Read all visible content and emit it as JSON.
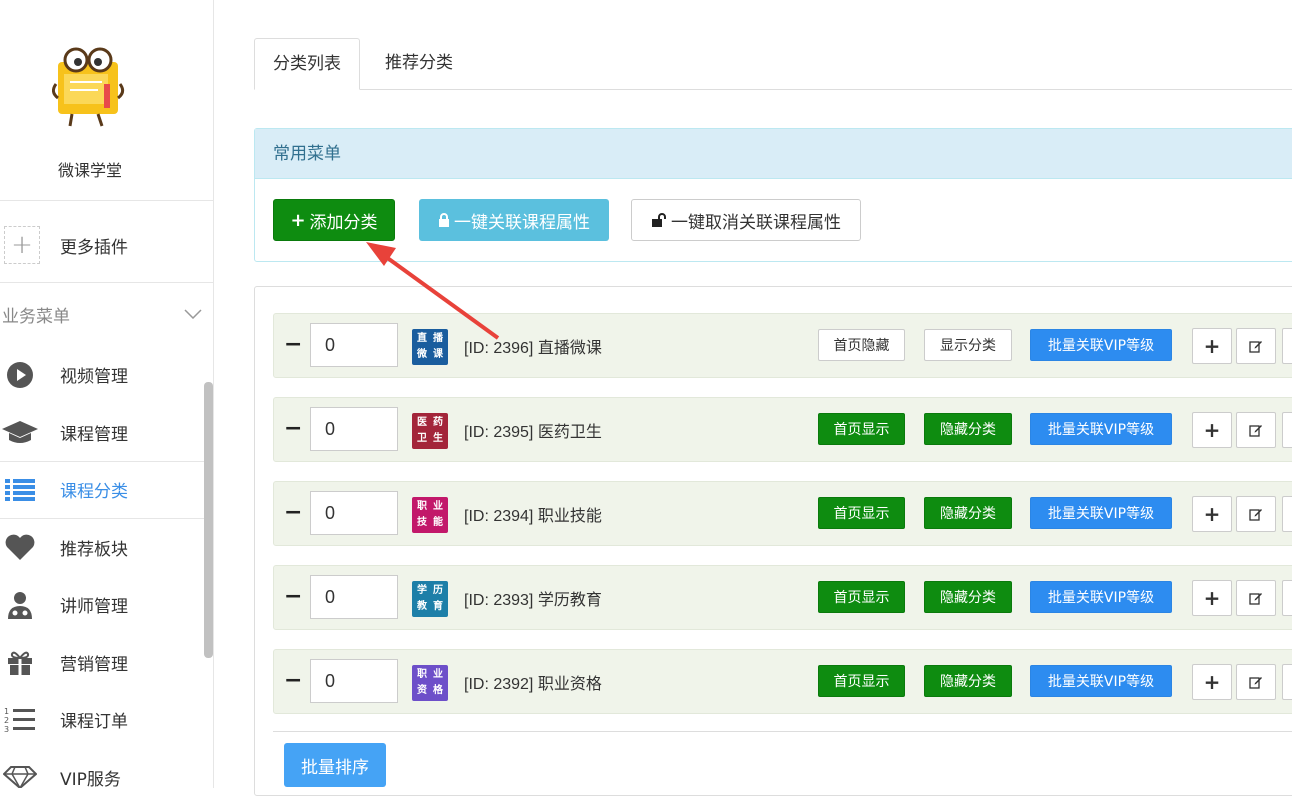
{
  "app": {
    "name": "微课学堂"
  },
  "sidebar": {
    "plugin_label": "更多插件",
    "section_title": "业务菜单",
    "items": [
      {
        "label": "视频管理",
        "icon": "play-icon"
      },
      {
        "label": "课程管理",
        "icon": "graduation-cap-icon"
      },
      {
        "label": "课程分类",
        "icon": "list-icon",
        "active": true
      },
      {
        "label": "推荐板块",
        "icon": "heart-icon"
      },
      {
        "label": "讲师管理",
        "icon": "user-md-icon"
      },
      {
        "label": "营销管理",
        "icon": "gift-icon"
      },
      {
        "label": "课程订单",
        "icon": "ordered-list-icon"
      },
      {
        "label": "VIP服务",
        "icon": "diamond-icon"
      }
    ]
  },
  "tabs": [
    {
      "label": "分类列表",
      "active": true
    },
    {
      "label": "推荐分类",
      "active": false
    }
  ],
  "panel": {
    "title": "常用菜单",
    "add_label": "添加分类",
    "link_label": "一键关联课程属性",
    "unlink_label": "一键取消关联课程属性"
  },
  "rows": [
    {
      "sort": "0",
      "title": "[ID: 2396] 直播微课",
      "thumb": [
        "直",
        "播",
        "微",
        "课"
      ],
      "thumb_color": "#1a5d9e",
      "home_label": "首页隐藏",
      "visibility_label": "显示分类",
      "vip_label": "批量关联VIP等级",
      "style": "white"
    },
    {
      "sort": "0",
      "title": "[ID: 2395] 医药卫生",
      "thumb": [
        "医",
        "药",
        "卫",
        "生"
      ],
      "thumb_color": "#a3253a",
      "home_label": "首页显示",
      "visibility_label": "隐藏分类",
      "vip_label": "批量关联VIP等级",
      "style": "green"
    },
    {
      "sort": "0",
      "title": "[ID: 2394] 职业技能",
      "thumb": [
        "职",
        "业",
        "技",
        "能"
      ],
      "thumb_color": "#c2186a",
      "home_label": "首页显示",
      "visibility_label": "隐藏分类",
      "vip_label": "批量关联VIP等级",
      "style": "green"
    },
    {
      "sort": "0",
      "title": "[ID: 2393] 学历教育",
      "thumb": [
        "学",
        "历",
        "教",
        "育"
      ],
      "thumb_color": "#1d7fa8",
      "home_label": "首页显示",
      "visibility_label": "隐藏分类",
      "vip_label": "批量关联VIP等级",
      "style": "green"
    },
    {
      "sort": "0",
      "title": "[ID: 2392] 职业资格",
      "thumb": [
        "职",
        "业",
        "资",
        "格"
      ],
      "thumb_color": "#6d4fc9",
      "home_label": "首页显示",
      "visibility_label": "隐藏分类",
      "vip_label": "批量关联VIP等级",
      "style": "green"
    }
  ],
  "batch_sort_label": "批量排序",
  "colors": {
    "accent": "#3a8ee6",
    "green": "#0e8c10",
    "info": "#5bc0de",
    "vip": "#2d8cf0",
    "arrow": "#e8423a"
  }
}
